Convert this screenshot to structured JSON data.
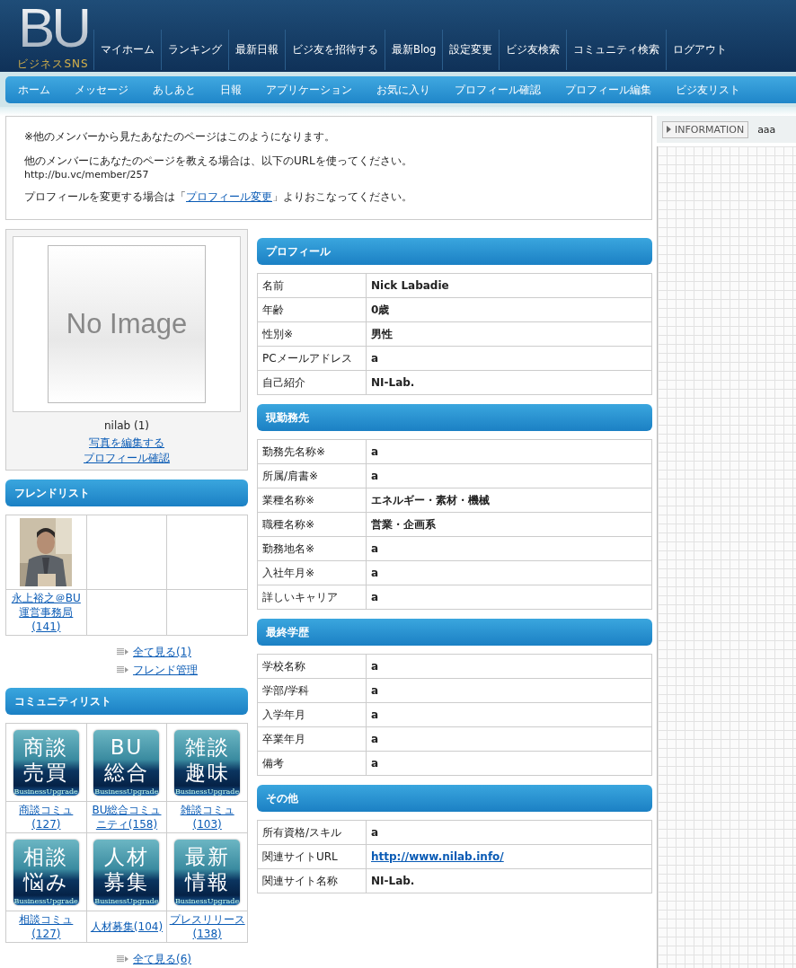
{
  "header": {
    "logo": "BU",
    "logo_subtitle": "ビジネスSNS",
    "top_nav": [
      {
        "label": "マイホーム"
      },
      {
        "label": "ランキング"
      },
      {
        "label": "最新日報"
      },
      {
        "label": "ビジ友を招待する"
      },
      {
        "label": "最新Blog"
      },
      {
        "label": "設定変更"
      },
      {
        "label": "ビジ友検索"
      },
      {
        "label": "コミュニティ検索"
      },
      {
        "label": "ログアウト"
      }
    ],
    "sub_nav": [
      {
        "label": "ホーム"
      },
      {
        "label": "メッセージ"
      },
      {
        "label": "あしあと"
      },
      {
        "label": "日報"
      },
      {
        "label": "アプリケーション"
      },
      {
        "label": "お気に入り"
      },
      {
        "label": "プロフィール確認"
      },
      {
        "label": "プロフィール編集"
      },
      {
        "label": "ビジ友リスト"
      }
    ]
  },
  "notice": {
    "line_1": "※他のメンバーから見たあなたのページはこのようになります。",
    "line_2": "他のメンバーにあなたのページを教える場合は、以下のURLを使ってください。",
    "url": "http://bu.vc/member/257",
    "line_3_before": "プロフィールを変更する場合は「",
    "line_3_link": "プロフィール変更",
    "line_3_after": "」よりおこなってください。"
  },
  "profile_card": {
    "image_text": "No Image",
    "name": "nilab (1)",
    "links": [
      "写真を編集する",
      "プロフィール確認"
    ]
  },
  "friend_list": {
    "title": "フレンドリスト",
    "friends": [
      {
        "name": "永上裕之＠BU運営事務局",
        "count": "(141)"
      }
    ],
    "links": [
      "全て見る(1)",
      "フレンド管理"
    ]
  },
  "community_list": {
    "title": "コミュニティリスト",
    "communities": [
      {
        "icon_text": [
          "商談",
          "売買"
        ],
        "icon_brand": "BusinessUpgrade",
        "name": "商談コミュ",
        "count": "(127)"
      },
      {
        "icon_text": [
          "BU",
          "総合"
        ],
        "icon_brand": "BusinessUpgrade",
        "name": "BU総合コミュニティ",
        "count": "(158)"
      },
      {
        "icon_text": [
          "雑談",
          "趣味"
        ],
        "icon_brand": "BusinessUpgrade",
        "name": "雑談コミュ",
        "count": "(103)"
      },
      {
        "icon_text": [
          "相談",
          "悩み"
        ],
        "icon_brand": "BusinessUpgrade",
        "name": "相談コミュ",
        "count": "(127)"
      },
      {
        "icon_text": [
          "人材",
          "募集"
        ],
        "icon_brand": "BusinessUpgrade",
        "name": "人材募集",
        "count": "(104)"
      },
      {
        "icon_text": [
          "最新",
          "情報"
        ],
        "icon_brand": "BusinessUpgrade",
        "name": "プレスリリース",
        "count": "(138)"
      }
    ],
    "links": [
      "全て見る(6)"
    ]
  },
  "sections": [
    {
      "title": "プロフィール",
      "rows": [
        {
          "label": "名前",
          "value": "Nick Labadie",
          "kind": "text"
        },
        {
          "label": "年齢",
          "value": "0歳",
          "kind": "text"
        },
        {
          "label": "性別※",
          "value": "男性",
          "kind": "text"
        },
        {
          "label": "PCメールアドレス",
          "value": "a",
          "kind": "text"
        },
        {
          "label": "自己紹介",
          "value": "NI-Lab.",
          "kind": "text"
        }
      ]
    },
    {
      "title": "現勤務先",
      "rows": [
        {
          "label": "勤務先名称※",
          "value": "a",
          "kind": "text"
        },
        {
          "label": "所属/肩書※",
          "value": "a",
          "kind": "text"
        },
        {
          "label": "業種名称※",
          "value": "エネルギー・素材・機械",
          "kind": "text"
        },
        {
          "label": "職種名称※",
          "value": "営業・企画系",
          "kind": "text"
        },
        {
          "label": "勤務地名※",
          "value": "a",
          "kind": "text"
        },
        {
          "label": "入社年月※",
          "value": "a",
          "kind": "text"
        },
        {
          "label": "詳しいキャリア",
          "value": "a",
          "kind": "text"
        }
      ]
    },
    {
      "title": "最終学歴",
      "rows": [
        {
          "label": "学校名称",
          "value": "a",
          "kind": "text"
        },
        {
          "label": "学部/学科",
          "value": "a",
          "kind": "text"
        },
        {
          "label": "入学年月",
          "value": "a",
          "kind": "text"
        },
        {
          "label": "卒業年月",
          "value": "a",
          "kind": "text"
        },
        {
          "label": "備考",
          "value": "a",
          "kind": "text"
        }
      ]
    },
    {
      "title": "その他",
      "rows": [
        {
          "label": "所有資格/スキル",
          "value": "a",
          "kind": "text"
        },
        {
          "label": "関連サイトURL",
          "value": "http://www.nilab.info/",
          "kind": "link"
        },
        {
          "label": "関連サイト名称",
          "value": "NI-Lab.",
          "kind": "text"
        }
      ]
    }
  ],
  "information": {
    "button": "INFORMATION",
    "text": "aaa"
  }
}
